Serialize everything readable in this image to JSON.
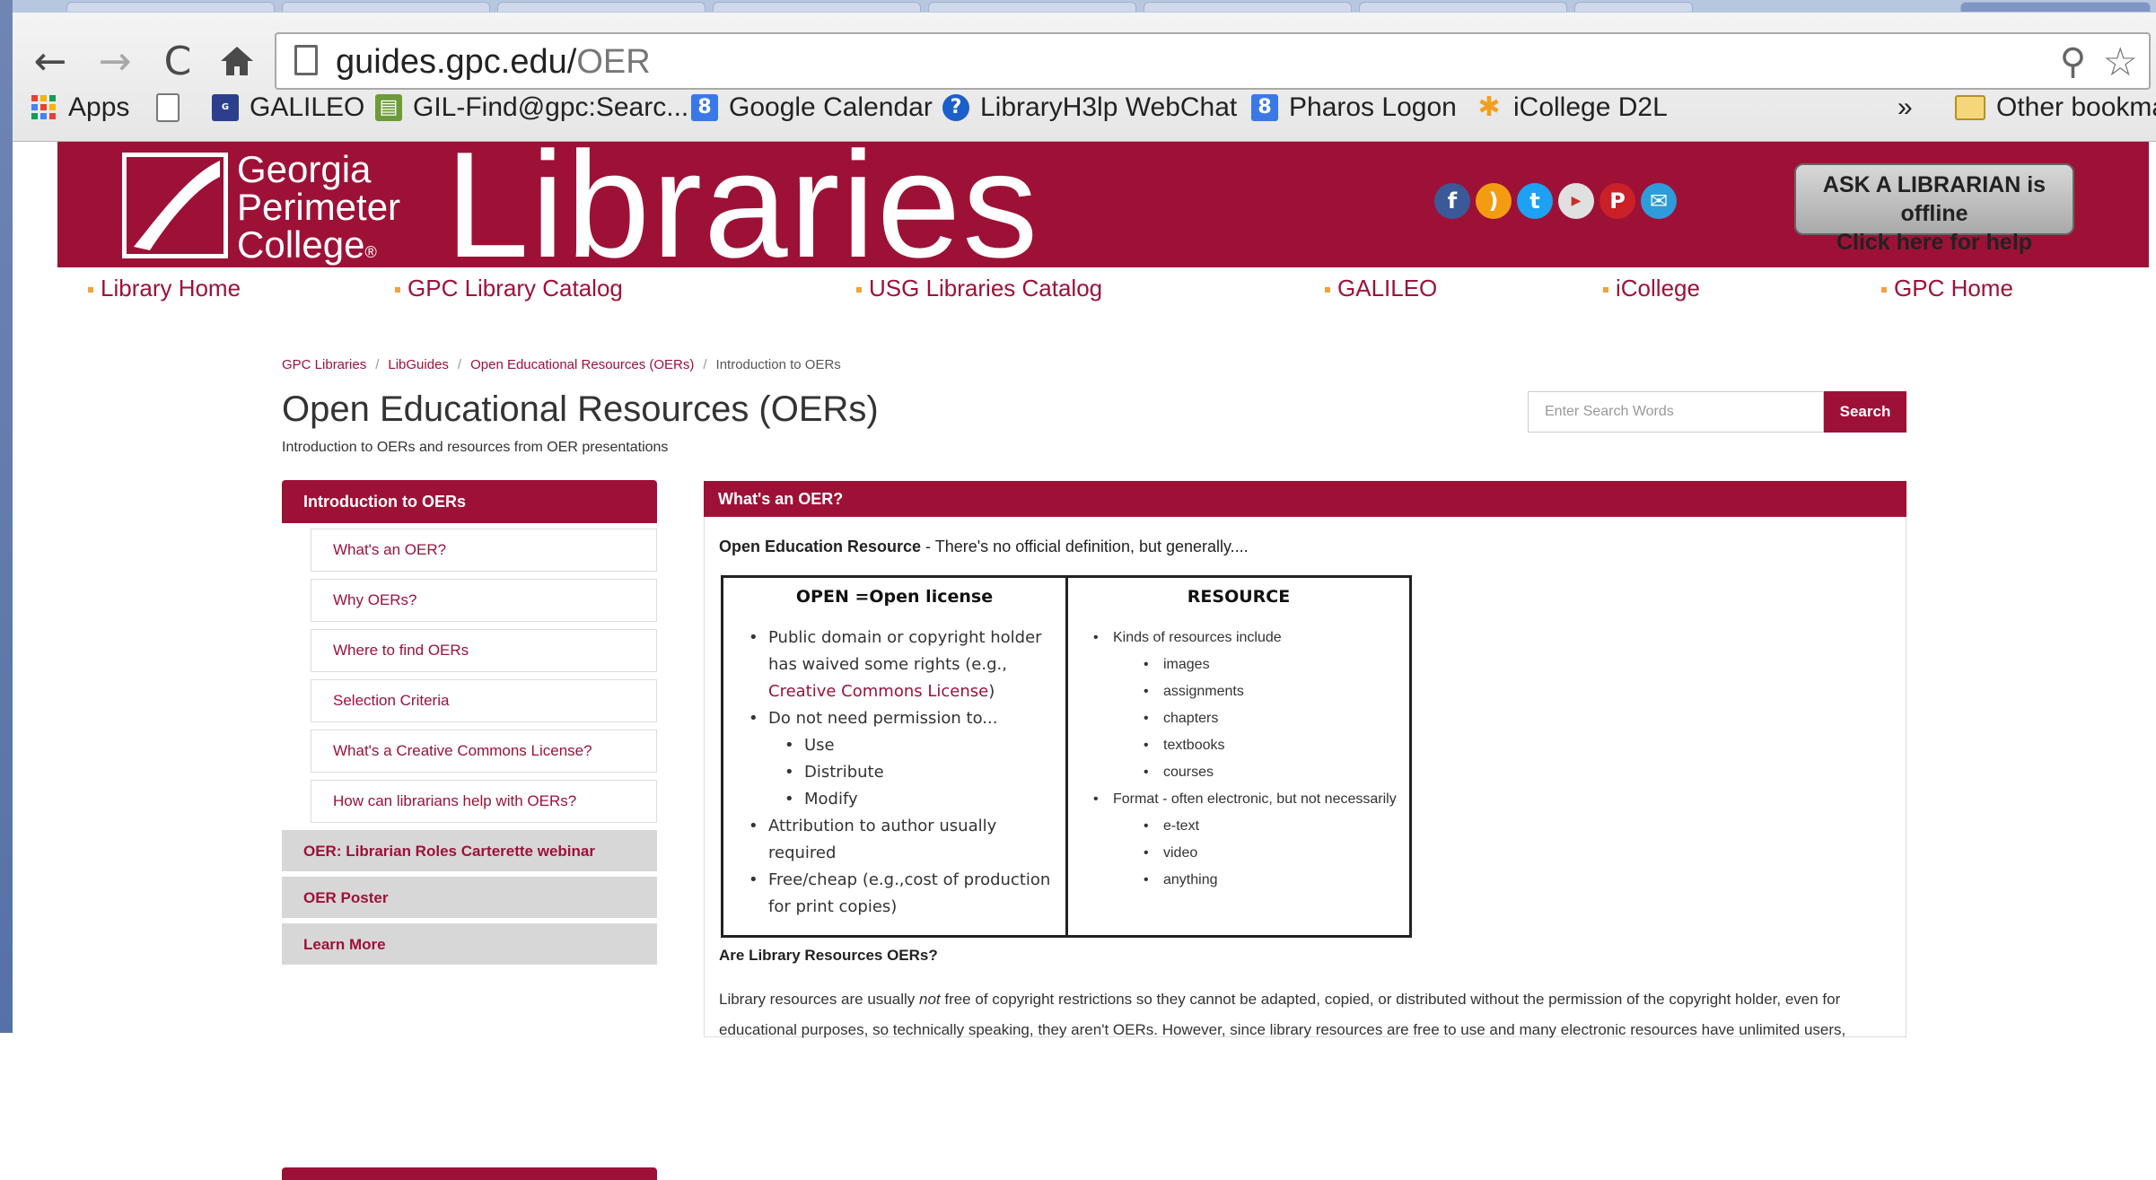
{
  "browser": {
    "url_host": "guides.gpc.edu/",
    "url_path": "OER",
    "back_icon": "arrow-left",
    "forward_icon": "arrow-right",
    "reload_icon": "reload",
    "home_icon": "home",
    "bookmarks": [
      {
        "label": "Apps",
        "icon": "apps-grid-icon"
      },
      {
        "label": "",
        "icon": "blank-page-icon"
      },
      {
        "label": "GALILEO",
        "icon": "galileo-icon"
      },
      {
        "label": "GIL-Find@gpc:Searc...",
        "icon": "gil-find-icon"
      },
      {
        "label": "Google Calendar",
        "icon": "google-icon"
      },
      {
        "label": "LibraryH3lp WebChat",
        "icon": "help-icon"
      },
      {
        "label": "Pharos Logon",
        "icon": "google-icon"
      },
      {
        "label": "iCollege D2L",
        "icon": "sparkle-icon"
      }
    ],
    "overflow": "»",
    "other_bookmarks": "Other bookma"
  },
  "site": {
    "logo_line1": "Georgia",
    "logo_line2": "Perimeter",
    "logo_line3": "College",
    "logo_mark": "®",
    "logo_big": "Libraries",
    "ask_line1": "ASK A LIBRARIAN is offline",
    "ask_line2": "Click here for help",
    "nav": [
      "Library Home",
      "GPC Library Catalog",
      "USG Libraries Catalog",
      "GALILEO",
      "iCollege",
      "GPC Home"
    ],
    "colors": {
      "brand": "#9e1137",
      "nav_bullet": "#f0a33b"
    }
  },
  "breadcrumb": [
    "GPC Libraries",
    "LibGuides",
    "Open Educational Resources (OERs)",
    "Introduction to OERs"
  ],
  "breadcrumb_sep": "/",
  "page": {
    "title": "Open Educational Resources (OERs)",
    "subtitle": "Introduction to OERs and resources from OER presentations"
  },
  "search": {
    "placeholder": "Enter Search Words",
    "button": "Search"
  },
  "sidenav": {
    "active": "Introduction to OERs",
    "sub": [
      "What's an OER?",
      "Why OERs?",
      "Where to find OERs",
      "Selection Criteria",
      "What's a Creative Commons License?",
      "How can librarians help with OERs?"
    ],
    "others": [
      "OER: Librarian Roles Carterette webinar",
      "OER Poster",
      "Learn More"
    ]
  },
  "content": {
    "header": "What's an OER?",
    "intro_bold": "Open Education Resource",
    "intro_rest": " - There's no official definition, but generally....",
    "table": {
      "left_head": "OPEN =Open license",
      "right_head": "RESOURCE",
      "left_items": [
        {
          "pre": "Public domain or copyright holder has waived some rights (e.g., ",
          "link": "Creative Commons License",
          "post": ")"
        },
        {
          "pre": "Do not need permission to...",
          "link": "",
          "post": ""
        },
        {
          "pre": "Use",
          "link": "",
          "post": "",
          "sub": true
        },
        {
          "pre": "Distribute",
          "link": "",
          "post": "",
          "sub": true
        },
        {
          "pre": "Modify",
          "link": "",
          "post": "",
          "sub": true
        },
        {
          "pre": "Attribution to author usually required",
          "link": "",
          "post": ""
        },
        {
          "pre": "Free/cheap (e.g.,cost of production for print copies)",
          "link": "",
          "post": ""
        }
      ],
      "right_items": [
        {
          "text": "Kinds of resources include"
        },
        {
          "text": "images",
          "sub": true
        },
        {
          "text": "assignments",
          "sub": true
        },
        {
          "text": "chapters",
          "sub": true
        },
        {
          "text": "textbooks",
          "sub": true
        },
        {
          "text": "courses",
          "sub": true
        },
        {
          "text": "Format - often electronic, but not necessarily"
        },
        {
          "text": "e-text",
          "sub": true
        },
        {
          "text": "video",
          "sub": true
        },
        {
          "text": "anything",
          "sub": true
        }
      ]
    },
    "question": "Are Library Resources OERs?",
    "para_pre": "Library resources are usually ",
    "para_em": "not",
    "para_post": " free of copyright restrictions so they cannot be adapted, copied, or distributed without the permission of the copyright holder, even for educational purposes, so technically speaking, they aren't OERs. However, since library resources are free to use and many electronic resources have unlimited users,"
  }
}
